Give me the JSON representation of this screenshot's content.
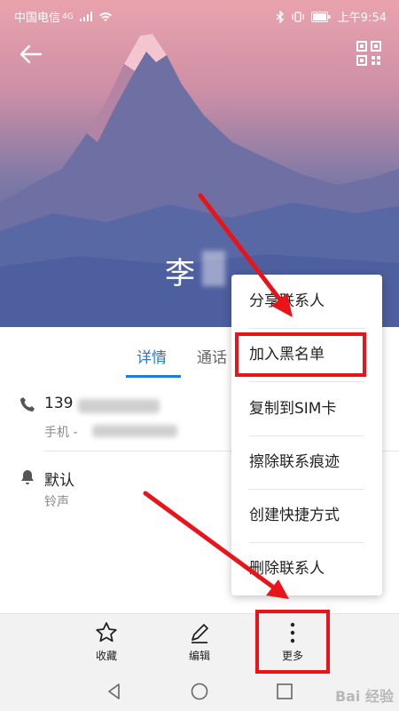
{
  "status_bar": {
    "carrier": "中国电信",
    "network": "4G",
    "time": "上午9:54"
  },
  "contact": {
    "name": "李"
  },
  "tabs": [
    {
      "label": "详情"
    },
    {
      "label": "通话"
    }
  ],
  "rows": [
    {
      "main": "139",
      "sub": "手机 -"
    },
    {
      "main": "默认",
      "sub": "铃声"
    }
  ],
  "menu": {
    "items": [
      {
        "label": "分享联系人"
      },
      {
        "label": "加入黑名单"
      },
      {
        "label": "复制到SIM卡"
      },
      {
        "label": "擦除联系痕迹"
      },
      {
        "label": "创建快捷方式"
      },
      {
        "label": "删除联系人"
      }
    ]
  },
  "toolbar": {
    "favorite_label": "收藏",
    "edit_label": "编辑",
    "more_label": "更多"
  },
  "watermark": "Bai 经验",
  "icons": [
    "back-arrow-icon",
    "qr-code-icon",
    "phone-icon",
    "bell-icon",
    "star-icon",
    "pencil-icon",
    "more-vertical-icon",
    "nav-back-icon",
    "nav-home-icon",
    "nav-recent-icon"
  ],
  "colors": {
    "accent": "#1e7bd8",
    "highlight": "#e8141a"
  }
}
